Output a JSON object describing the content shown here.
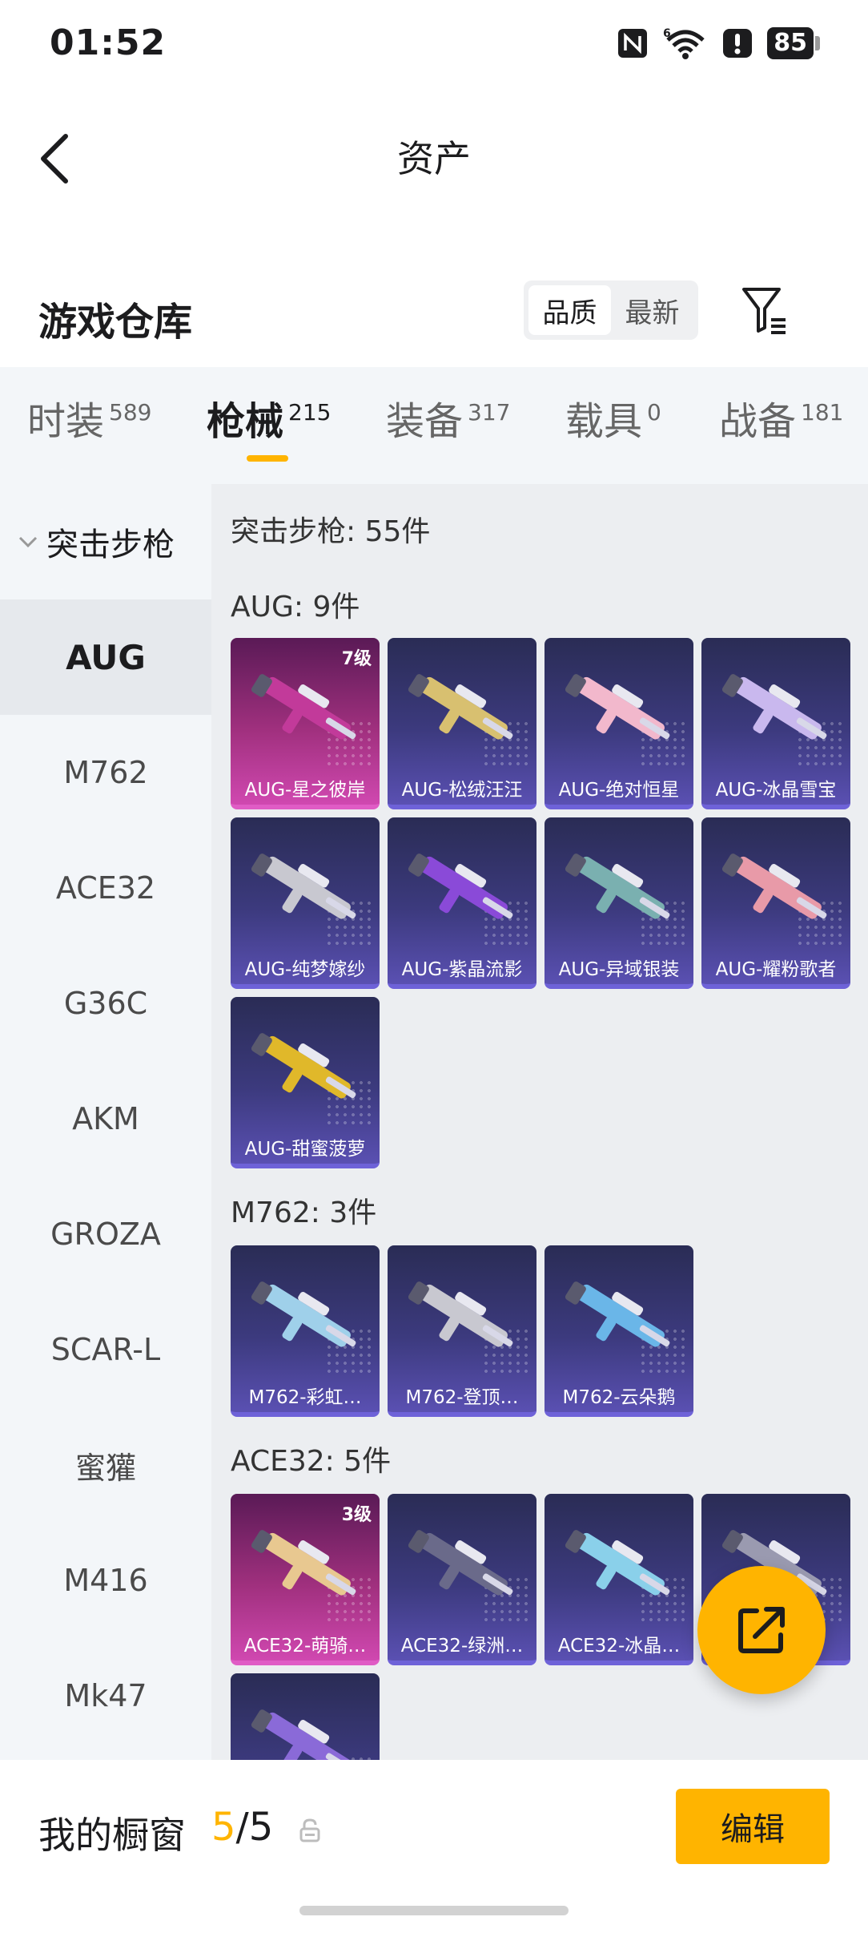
{
  "status": {
    "time": "01:52",
    "battery": "85",
    "icons": [
      "nfc-icon",
      "wifi-6-icon",
      "alert-icon",
      "battery-icon"
    ]
  },
  "header": {
    "title": "资产"
  },
  "section": {
    "title": "游戏仓库",
    "sort": {
      "quality": "品质",
      "newest": "最新",
      "active": "quality"
    }
  },
  "tabs": [
    {
      "label": "时装",
      "count": "589"
    },
    {
      "label": "枪械",
      "count": "215",
      "active": true
    },
    {
      "label": "装备",
      "count": "317"
    },
    {
      "label": "载具",
      "count": "0"
    },
    {
      "label": "战备",
      "count": "181"
    }
  ],
  "sidebar": {
    "group": "突击步枪",
    "items": [
      "AUG",
      "M762",
      "ACE32",
      "G36C",
      "AKM",
      "GROZA",
      "SCAR-L",
      "蜜獾",
      "M416",
      "Mk47"
    ],
    "active": "AUG"
  },
  "main": {
    "total": "突击步枪: 55件",
    "categories": [
      {
        "title": "AUG: 9件",
        "items": [
          {
            "name": "AUG-星之彼岸",
            "level": "7级",
            "rarity": "legendary"
          },
          {
            "name": "AUG-松绒汪汪",
            "rarity": "epic"
          },
          {
            "name": "AUG-绝对恒星",
            "rarity": "epic"
          },
          {
            "name": "AUG-冰晶雪宝",
            "rarity": "epic"
          },
          {
            "name": "AUG-纯梦嫁纱",
            "rarity": "epic"
          },
          {
            "name": "AUG-紫晶流影",
            "rarity": "epic"
          },
          {
            "name": "AUG-异域银装",
            "rarity": "epic"
          },
          {
            "name": "AUG-耀粉歌者",
            "rarity": "epic"
          },
          {
            "name": "AUG-甜蜜菠萝",
            "rarity": "epic"
          }
        ]
      },
      {
        "title": "M762: 3件",
        "items": [
          {
            "name": "M762-彩虹…",
            "rarity": "epic"
          },
          {
            "name": "M762-登顶…",
            "rarity": "epic"
          },
          {
            "name": "M762-云朵鹅",
            "rarity": "epic"
          }
        ]
      },
      {
        "title": "ACE32: 5件",
        "items": [
          {
            "name": "ACE32-萌骑…",
            "level": "3级",
            "rarity": "legendary"
          },
          {
            "name": "ACE32-绿洲…",
            "rarity": "epic"
          },
          {
            "name": "ACE32-冰晶…",
            "rarity": "epic"
          },
          {
            "name": "…",
            "rarity": "epic"
          },
          {
            "name": "",
            "rarity": "epic"
          }
        ]
      }
    ]
  },
  "fab": {
    "icon": "share-icon"
  },
  "bottom": {
    "window_label": "我的橱窗",
    "window_current": "5",
    "window_total": "/5",
    "edit_label": "编辑"
  },
  "colors": {
    "accent": "#ffb400",
    "epic_card": "#3c3a7e",
    "legendary_card": "#a0307e"
  }
}
